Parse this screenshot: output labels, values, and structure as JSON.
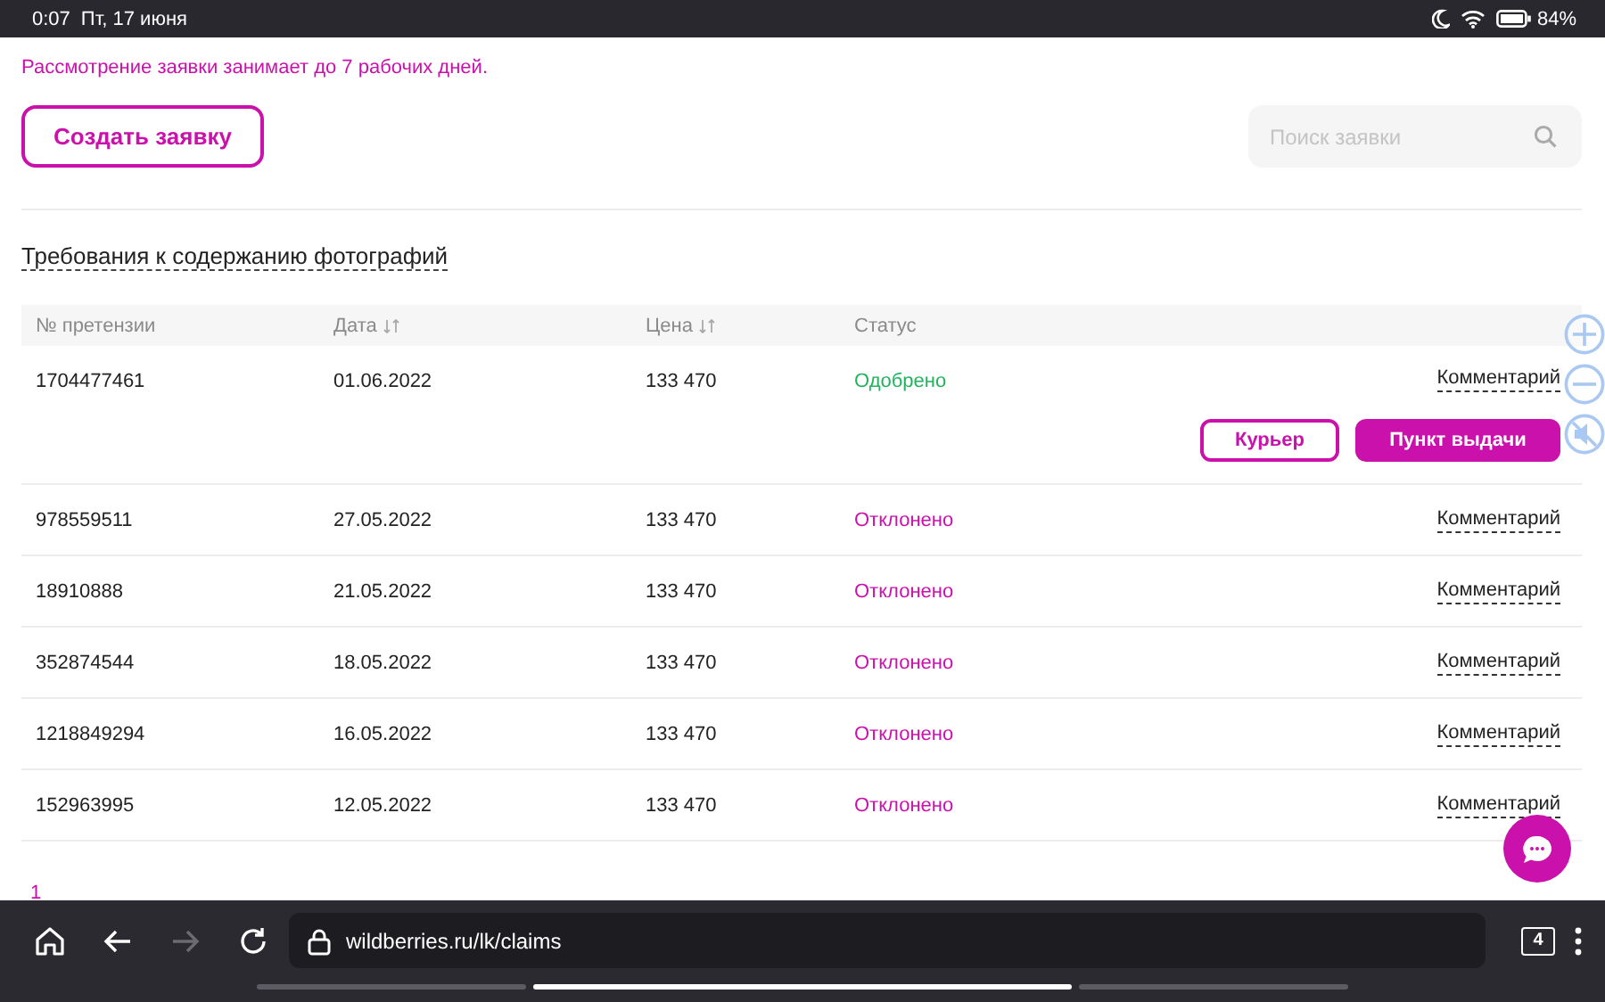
{
  "status_bar": {
    "time": "0:07",
    "date": "Пт, 17 июня",
    "battery": "84%"
  },
  "notice": "Рассмотрение заявки занимает до 7 рабочих дней.",
  "create_button": "Создать заявку",
  "search": {
    "placeholder": "Поиск заявки"
  },
  "requirements_link": "Требования к содержанию фотографий",
  "table": {
    "columns": [
      {
        "label": "№ претензии",
        "sortable": false
      },
      {
        "label": "Дата",
        "sortable": true
      },
      {
        "label": "Цена",
        "sortable": true
      },
      {
        "label": "Статус",
        "sortable": false
      }
    ],
    "rows": [
      {
        "claim_no": "1704477461",
        "date": "01.06.2022",
        "price": "133 470",
        "status": {
          "text": "Одобрено",
          "kind": "approved"
        },
        "comment": "Комментарий",
        "actions": [
          {
            "label": "Курьер",
            "kind": "outline"
          },
          {
            "label": "Пункт выдачи",
            "kind": "filled"
          }
        ]
      },
      {
        "claim_no": "978559511",
        "date": "27.05.2022",
        "price": "133 470",
        "status": {
          "text": "Отклонено",
          "kind": "rejected"
        },
        "comment": "Комментарий"
      },
      {
        "claim_no": "18910888",
        "date": "21.05.2022",
        "price": "133 470",
        "status": {
          "text": "Отклонено",
          "kind": "rejected"
        },
        "comment": "Комментарий"
      },
      {
        "claim_no": "352874544",
        "date": "18.05.2022",
        "price": "133 470",
        "status": {
          "text": "Отклонено",
          "kind": "rejected"
        },
        "comment": "Комментарий"
      },
      {
        "claim_no": "1218849294",
        "date": "16.05.2022",
        "price": "133 470",
        "status": {
          "text": "Отклонено",
          "kind": "rejected"
        },
        "comment": "Комментарий"
      },
      {
        "claim_no": "152963995",
        "date": "12.05.2022",
        "price": "133 470",
        "status": {
          "text": "Отклонено",
          "kind": "rejected"
        },
        "comment": "Комментарий"
      }
    ]
  },
  "pagination": [
    {
      "label": "1",
      "selected": true
    }
  ],
  "browser": {
    "nav": [
      {
        "kind": "home",
        "disabled": false
      },
      {
        "kind": "back",
        "disabled": false
      },
      {
        "kind": "forward",
        "disabled": true
      },
      {
        "kind": "reload",
        "disabled": false
      }
    ],
    "url": "wildberries.ru/lk/claims",
    "tab_count": "4",
    "tab_strip": [
      {
        "selected": false
      },
      {
        "selected": true
      },
      {
        "selected": false
      }
    ]
  }
}
